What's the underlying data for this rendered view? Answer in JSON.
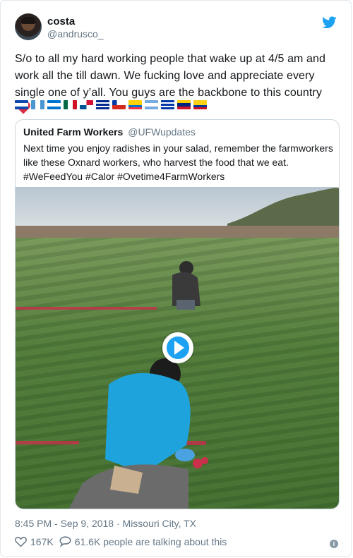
{
  "author": {
    "name": "costa",
    "handle": "@andrusco_",
    "avatar_alt": "avatar"
  },
  "tweet": {
    "text": "S/o to all my hard working people that wake up at 4/5 am and work all the till dawn. We fucking love and appreciate every single one of y’all. You guys are the backbone to this country",
    "trailing_emoji": "red-heart-icon",
    "flags": [
      "el-salvador",
      "guatemala",
      "honduras",
      "mexico",
      "panama",
      "cuba",
      "chile",
      "ecuador",
      "argentina",
      "uruguay",
      "venezuela",
      "colombia"
    ]
  },
  "quoted": {
    "name": "United Farm Workers",
    "handle": "@UFWupdates",
    "text": "Next time you enjoy radishes in your salad, remember the farmworkers like these Oxnard workers, who harvest the food that we eat. #WeFeedYou #Calor #Ovetime4FarmWorkers",
    "media": "video"
  },
  "meta": {
    "timestamp": "8:45 PM - Sep 9, 2018 · Missouri City, TX"
  },
  "actions": {
    "likes": "167K",
    "replies": "61.6K people are talking about this"
  },
  "colors": {
    "twitter_blue": "#1da1f2",
    "text_primary": "#14171a",
    "text_secondary": "#657786",
    "heart_red": "#e0245e"
  }
}
